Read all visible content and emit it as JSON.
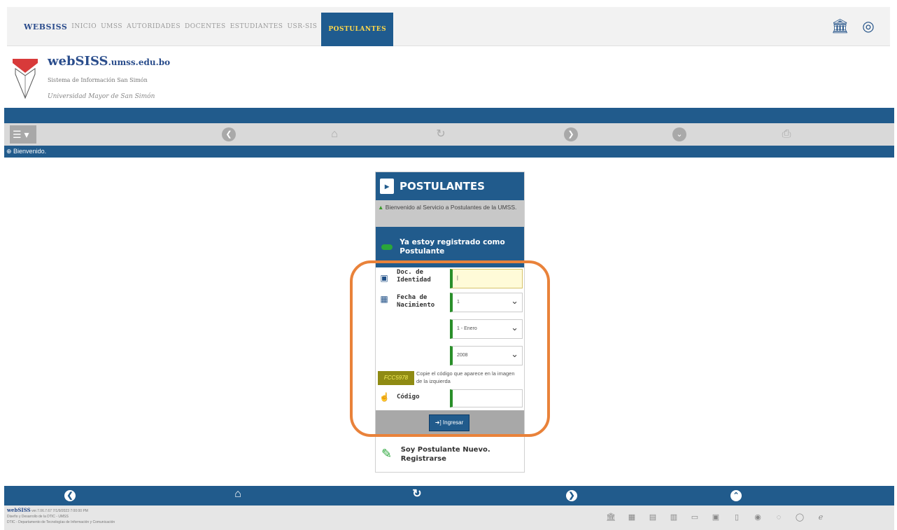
{
  "topnav": {
    "brand": "WEBSISS",
    "items": [
      "INICIO",
      "UMSS",
      "AUTORIDADES",
      "DOCENTES",
      "ESTUDIANTES",
      "USR-SIS"
    ],
    "active": "POSTULANTES",
    "icons": [
      "institution-icon",
      "user-circle-icon"
    ]
  },
  "header": {
    "logo_title": "webSISS",
    "logo_domain": ".umss.edu.bo",
    "subtitle": "Sistema de Información San Simón",
    "university": "Universidad Mayor de San Simón"
  },
  "toolbar": {
    "menu_label": "☰ ▾",
    "icons": [
      "back-icon",
      "home-icon",
      "refresh-icon",
      "forward-icon",
      "down-icon",
      "print-icon"
    ]
  },
  "status": {
    "text": "Bienvenido."
  },
  "panel": {
    "title": "POSTULANTES",
    "welcome": "Bienvenido al Servicio a Postulantes de la UMSS.",
    "registered_heading": "Ya estoy registrado como Postulante",
    "doc_label": "Doc. de Identidad",
    "doc_value": "|",
    "birth_label": "Fecha de Nacimiento",
    "day_value": "1",
    "month_value": "1 - Enero",
    "year_value": "2008",
    "captcha_value": "FCC5978",
    "captcha_hint": "Copie el código que aparece en la imagen de la izquierda",
    "code_label": "Código",
    "code_value": "",
    "submit_label": "➜] Ingresar",
    "new_user": "Soy Postulante Nuevo. Registrarse"
  },
  "footer": {
    "brand": "webSISS",
    "line1": "ver.7.06.7.67 7/1/9/2023 7:00:00 PM",
    "line2": "Diseño y Desarrollo de la DTIC - UMSS",
    "line3": "DTIC - Departamento de Tecnologías de Información y Comunicación"
  },
  "colors": {
    "primary": "#215b8c",
    "accent": "#ffd84a",
    "success": "#2aa63a",
    "highlight": "#e9823a"
  }
}
